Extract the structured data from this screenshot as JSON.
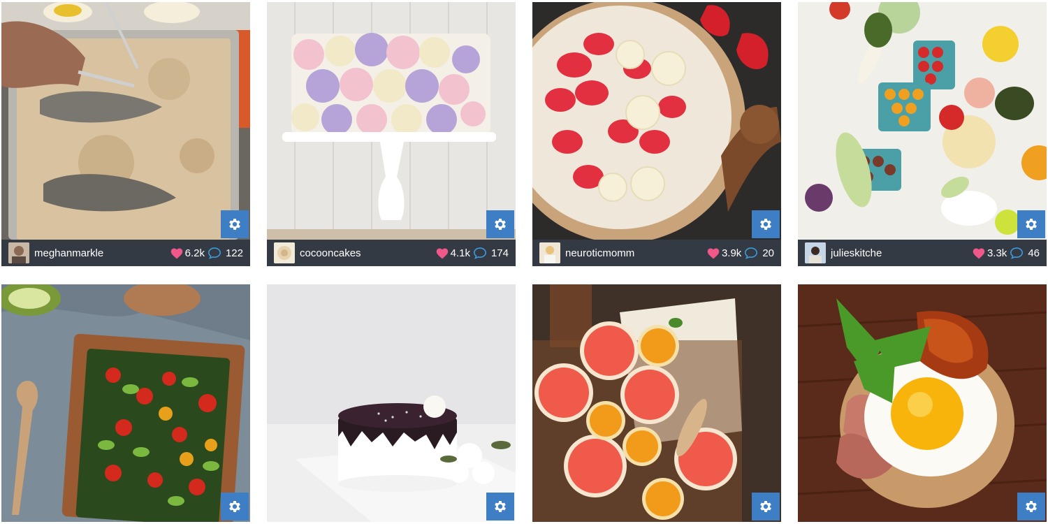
{
  "cards": [
    {
      "user": "meghanmarkle",
      "likes": "6.2k",
      "comments": "122"
    },
    {
      "user": "cocooncakes",
      "likes": "4.1k",
      "comments": "174"
    },
    {
      "user": "neuroticmomm",
      "likes": "3.9k",
      "comments": "20"
    },
    {
      "user": "julieskitche",
      "likes": "3.3k",
      "comments": "46"
    },
    {
      "user": "",
      "likes": "",
      "comments": ""
    },
    {
      "user": "",
      "likes": "",
      "comments": ""
    },
    {
      "user": "",
      "likes": "",
      "comments": ""
    },
    {
      "user": "",
      "likes": "",
      "comments": ""
    }
  ],
  "icons": {
    "settings": "gear-icon",
    "likes": "heart-icon",
    "comments": "comment-bubble-icon"
  },
  "colors": {
    "accent": "#3d7ec4",
    "bar": "#343a44",
    "heart": "#f0588a"
  }
}
